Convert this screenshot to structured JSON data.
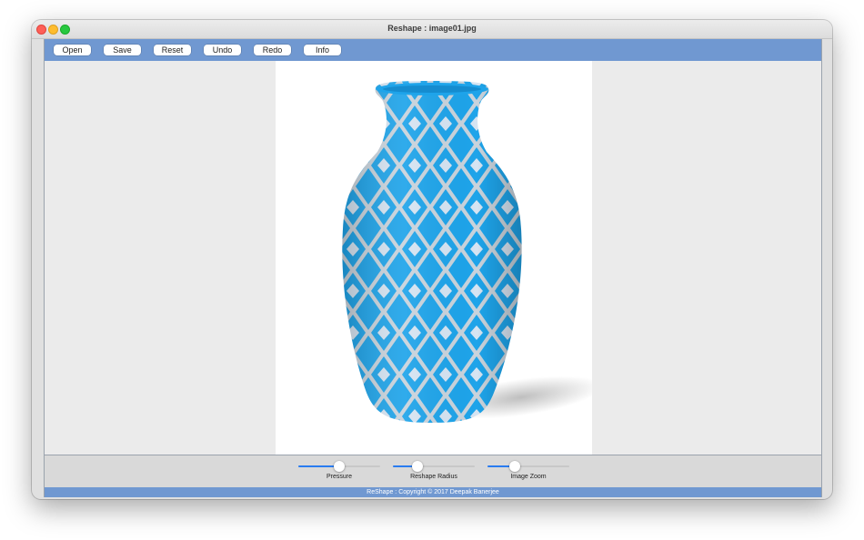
{
  "window": {
    "title": "Reshape : image01.jpg"
  },
  "toolbar": {
    "buttons": [
      {
        "label": "Open"
      },
      {
        "label": "Save"
      },
      {
        "label": "Reset"
      },
      {
        "label": "Undo"
      },
      {
        "label": "Redo"
      },
      {
        "label": "Info"
      }
    ]
  },
  "image": {
    "subject": "blue-diamond-pattern-vase"
  },
  "sliders": [
    {
      "label": "Pressure",
      "value": 0.5
    },
    {
      "label": "Reshape Radius",
      "value": 0.3
    },
    {
      "label": "Image Zoom",
      "value": 0.33
    }
  ],
  "statusbar": {
    "text": "ReShape : Copyright © 2017  Deepak Banerjee"
  },
  "colors": {
    "accent_blue": "#7098d1",
    "slider_fill": "#2a7cf0",
    "vase_blue": "#1ea4ea",
    "vase_pattern": "#c9d3dc"
  }
}
